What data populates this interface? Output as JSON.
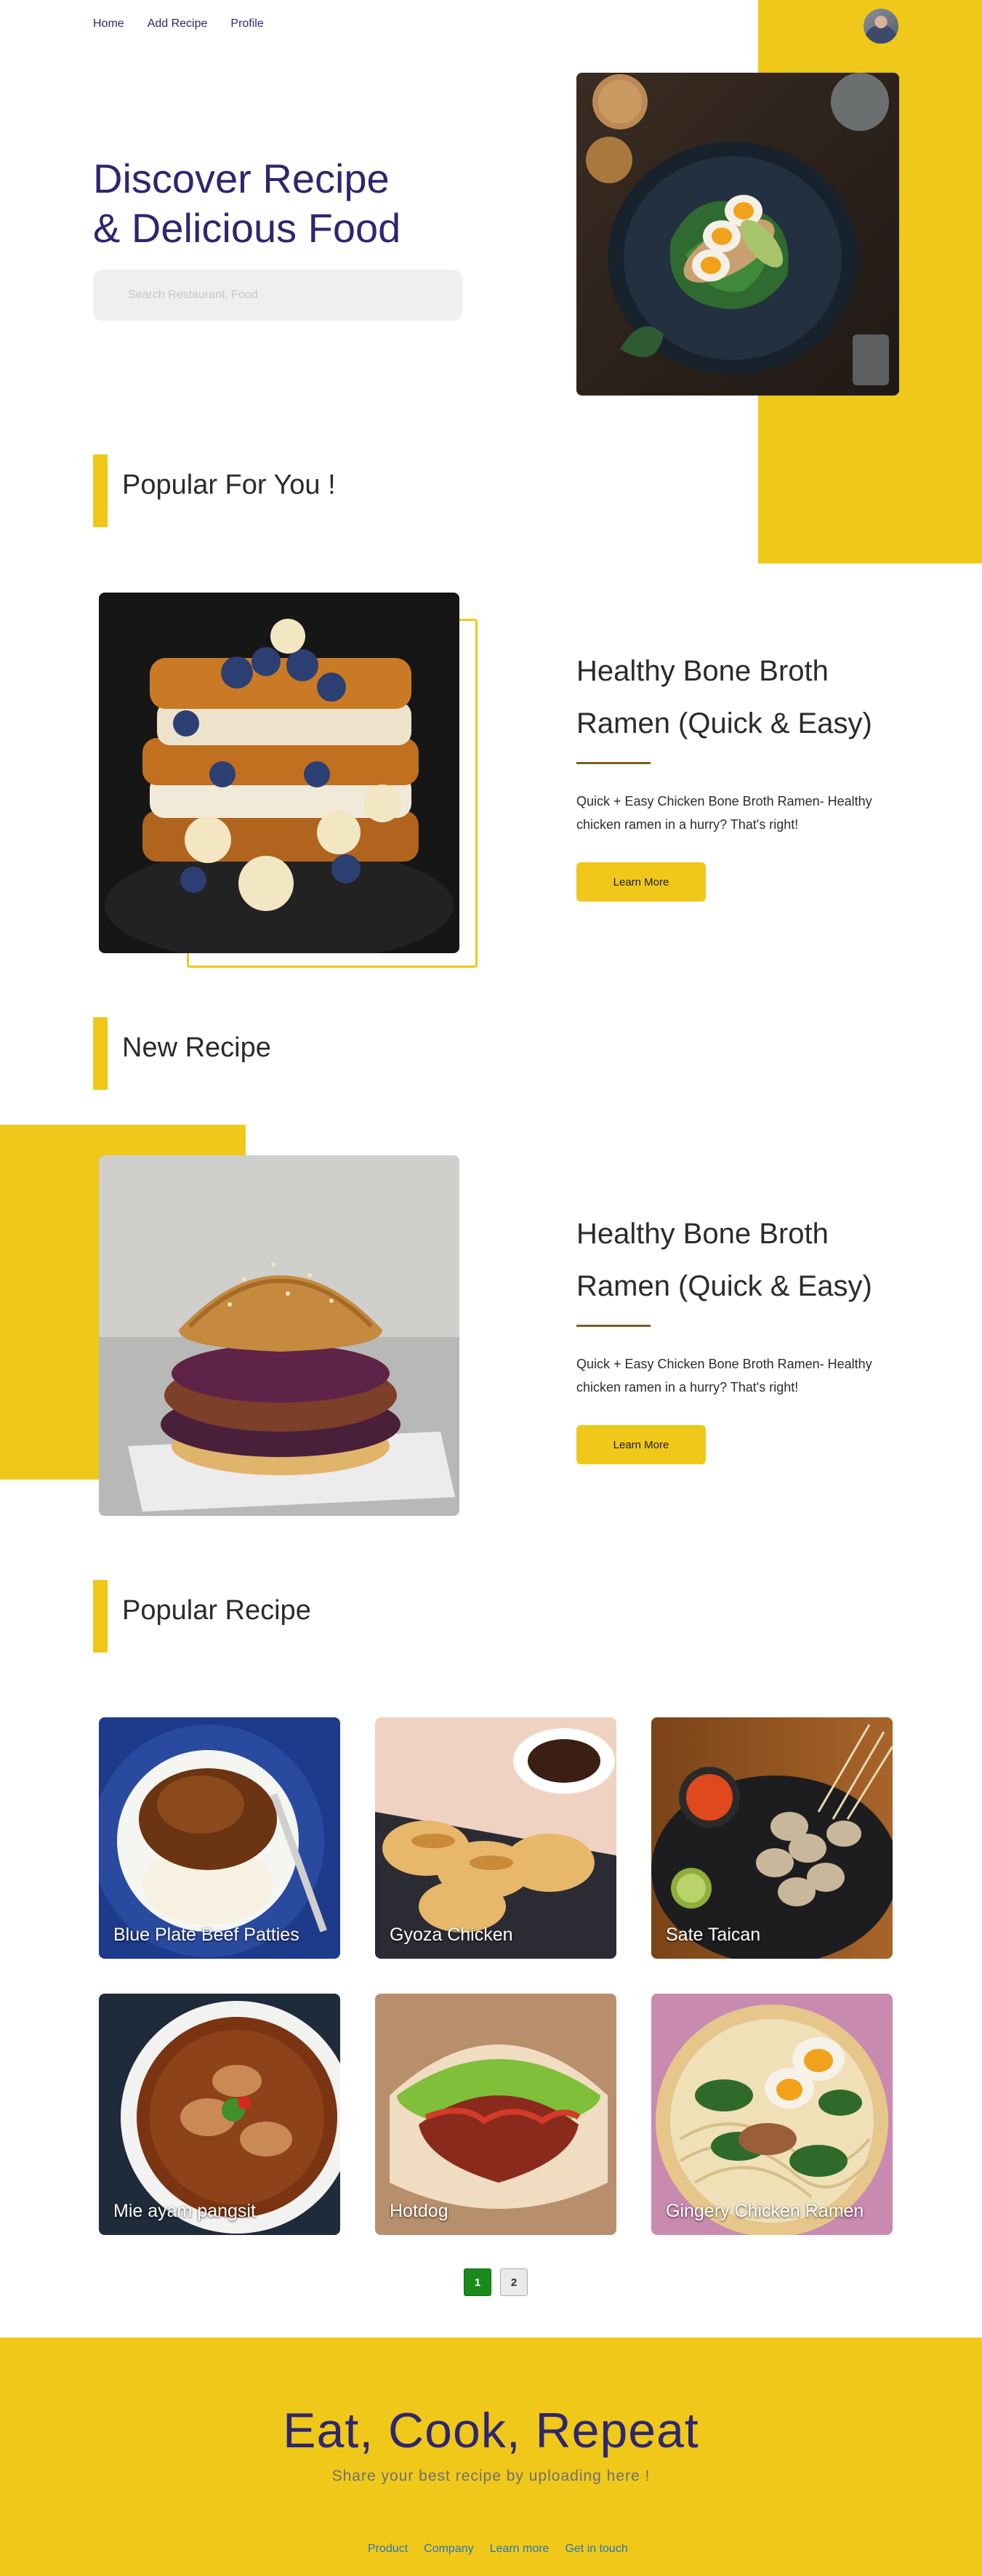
{
  "nav": {
    "items": [
      "Home",
      "Add Recipe",
      "Profile"
    ]
  },
  "hero": {
    "title_line1": "Discover Recipe",
    "title_line2": "& Delicious Food",
    "search_placeholder": "Search Restaurant, Food"
  },
  "sections": {
    "popular_for_you": "Popular For You !",
    "new_recipe": "New Recipe",
    "popular_recipe": "Popular Recipe"
  },
  "featured": [
    {
      "title": "Healthy Bone Broth Ramen (Quick & Easy)",
      "description": "Quick + Easy Chicken Bone Broth Ramen- Healthy chicken ramen in a hurry? That's right!",
      "button": "Learn More"
    },
    {
      "title": "Healthy Bone Broth Ramen (Quick & Easy)",
      "description": "Quick + Easy Chicken Bone Broth Ramen- Healthy chicken ramen in a hurry? That's right!",
      "button": "Learn More"
    }
  ],
  "recipes": [
    "Blue Plate Beef Patties",
    "Gyoza Chicken",
    "Sate Taican",
    "Mie ayam pangsit",
    "Hotdog",
    "Gingery Chicken Ramen"
  ],
  "pagination": {
    "pages": [
      "1",
      "2"
    ],
    "active": "1"
  },
  "footer": {
    "title": "Eat, Cook, Repeat",
    "subtitle": "Share your best recipe by uploading here !",
    "links": [
      "Product",
      "Company",
      "Learn more",
      "Get in touch"
    ]
  },
  "colors": {
    "accent": "#EFC81A",
    "brand": "#2E266F",
    "active_page": "#1a8a1a",
    "link": "#2876b4"
  }
}
